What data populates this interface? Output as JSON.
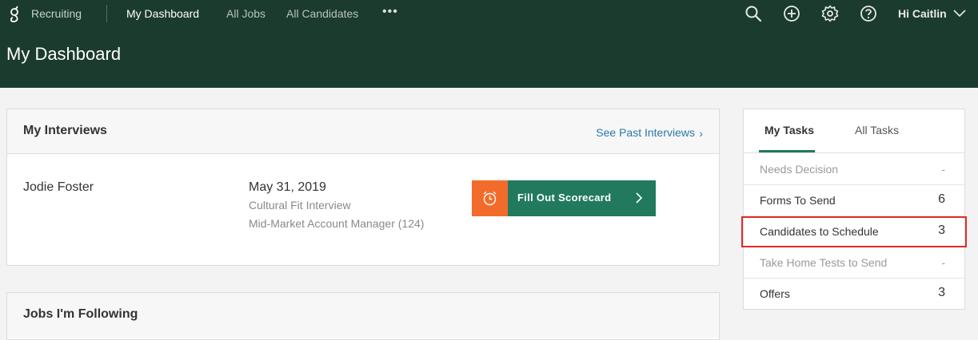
{
  "header": {
    "app_name": "Recruiting",
    "nav": [
      "My Dashboard",
      "All Jobs",
      "All Candidates"
    ],
    "more": "•••",
    "greeting": "Hi Caitlin",
    "page_title": "My Dashboard"
  },
  "interviews": {
    "title": "My Interviews",
    "past_link": "See Past Interviews",
    "items": [
      {
        "candidate": "Jodie Foster",
        "date": "May 31, 2019",
        "type": "Cultural Fit Interview",
        "job": "Mid-Market Account Manager (124)",
        "action": "Fill Out Scorecard"
      }
    ]
  },
  "following": {
    "title": "Jobs I'm Following"
  },
  "tasks": {
    "tabs": [
      "My Tasks",
      "All Tasks"
    ],
    "active_tab": "My Tasks",
    "rows": [
      {
        "label": "Needs Decision",
        "count": "-"
      },
      {
        "label": "Forms To Send",
        "count": "6"
      },
      {
        "label": "Candidates to Schedule",
        "count": "3"
      },
      {
        "label": "Take Home Tests to Send",
        "count": "-"
      },
      {
        "label": "Offers",
        "count": "3"
      }
    ]
  },
  "colors": {
    "header_bg": "#1b3b2e",
    "accent_green": "#217a5e",
    "alarm_orange": "#f26b2b",
    "link_blue": "#2a7aa8",
    "highlight_red": "#e22b2b"
  },
  "icons": [
    "greenhouse-logo",
    "search-icon",
    "add-icon",
    "gear-icon",
    "help-icon",
    "chevron-down-icon",
    "alarm-clock-icon",
    "chevron-right-icon"
  ]
}
